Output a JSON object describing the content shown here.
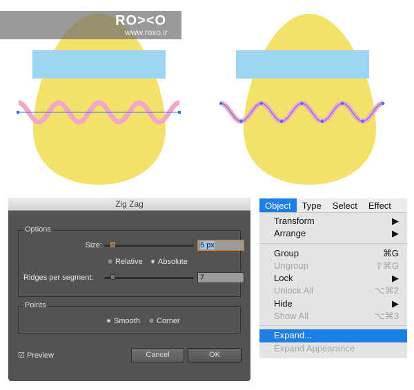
{
  "watermark": {
    "logo": "RO><O",
    "url": "www.roxo.ir"
  },
  "colors": {
    "egg": "#f4e16a",
    "band": "#9bd8f0",
    "wave": "#f2a6c8",
    "path": "#3b6fe0",
    "accent": "#1c7fe5"
  },
  "dialog": {
    "title": "Zig Zag",
    "options_label": "Options",
    "size_label": "Size:",
    "size_value": "5 px",
    "relative_label": "Relative",
    "absolute_label": "Absolute",
    "mode_selected": "Absolute",
    "ridges_label": "Ridges per segment:",
    "ridges_value": "7",
    "points_label": "Points",
    "smooth_label": "Smooth",
    "corner_label": "Corner",
    "points_selected": "Smooth",
    "preview_label": "Preview",
    "preview_checked": true,
    "cancel_label": "Cancel",
    "ok_label": "OK"
  },
  "menu": {
    "bar": [
      "Object",
      "Type",
      "Select",
      "Effect"
    ],
    "items": [
      {
        "label": "Transform",
        "shortcut": "▶"
      },
      {
        "label": "Arrange",
        "shortcut": "▶"
      },
      {
        "label": "Group",
        "shortcut": "⌘G"
      },
      {
        "label": "Ungroup",
        "shortcut": "⇧⌘G",
        "disabled": true
      },
      {
        "label": "Lock",
        "shortcut": "▶"
      },
      {
        "label": "Unlock All",
        "shortcut": "⌥⌘2",
        "disabled": true
      },
      {
        "label": "Hide",
        "shortcut": "▶"
      },
      {
        "label": "Show All",
        "shortcut": "⌥⌘3",
        "disabled": true
      },
      {
        "label": "Expand...",
        "selected": true
      },
      {
        "label": "Expand Appearance",
        "disabled": true
      }
    ]
  }
}
